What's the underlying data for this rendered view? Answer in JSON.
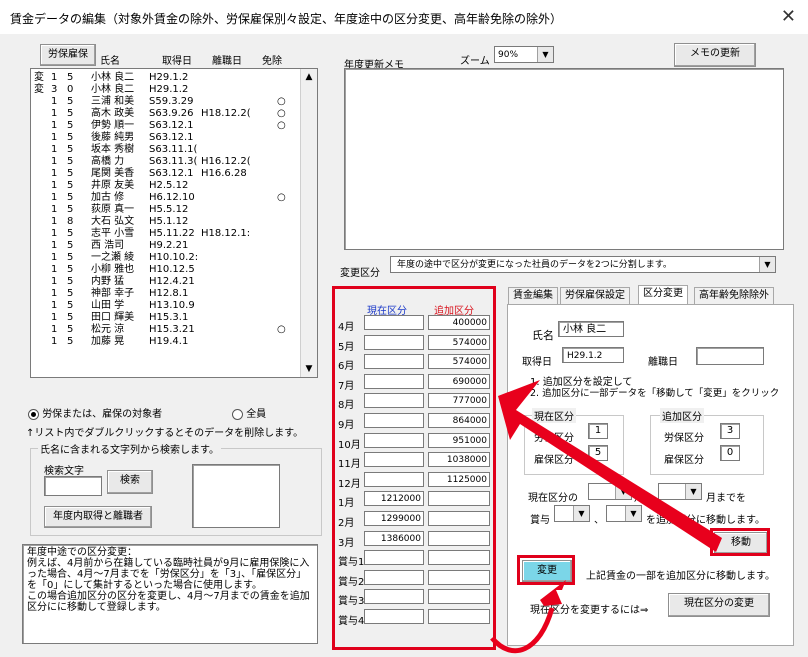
{
  "title": "賃金データの編集（対象外賃金の除外、労保雇保別々設定、年度途中の区分変更、高年齢免除の除外）",
  "close_glyph": "✕",
  "list": {
    "headers": {
      "rokoho": "労保雇保",
      "name": "氏名",
      "shutoku": "取得日",
      "rishoku": "離職日",
      "menjo": "免除"
    },
    "rows": [
      [
        "変",
        "1",
        "5",
        "小林 良二",
        "H29.1.2",
        "",
        ""
      ],
      [
        "変",
        "3",
        "0",
        "小林 良二",
        "H29.1.2",
        "",
        ""
      ],
      [
        "",
        "1",
        "5",
        "三浦 和美",
        "S59.3.29",
        "",
        "○"
      ],
      [
        "",
        "1",
        "5",
        "高木 政美",
        "S63.9.26",
        "H18.12.2(",
        "○"
      ],
      [
        "",
        "1",
        "5",
        "伊勢 順一",
        "S63.12.1",
        "",
        "○"
      ],
      [
        "",
        "1",
        "5",
        "後藤 純男",
        "S63.12.1",
        "",
        ""
      ],
      [
        "",
        "1",
        "5",
        "坂本 秀樹",
        "S63.11.1(",
        "",
        ""
      ],
      [
        "",
        "1",
        "5",
        "高橋 力",
        "S63.11.3(",
        "H16.12.2(",
        ""
      ],
      [
        "",
        "1",
        "5",
        "尾関 美香",
        "S63.12.1",
        "H16.6.28",
        ""
      ],
      [
        "",
        "1",
        "5",
        "井原 友美",
        "H2.5.12",
        "",
        ""
      ],
      [
        "",
        "1",
        "5",
        "加古 修",
        "H6.12.10",
        "",
        "○"
      ],
      [
        "",
        "1",
        "5",
        "荻原 真一",
        "H5.5.12",
        "",
        ""
      ],
      [
        "",
        "1",
        "8",
        "大石 弘文",
        "H5.1.12",
        "",
        ""
      ],
      [
        "",
        "1",
        "5",
        "志平 小雪",
        "H5.11.22",
        "H18.12.1:",
        ""
      ],
      [
        "",
        "1",
        "5",
        "西 浩司",
        "H9.2.21",
        "",
        ""
      ],
      [
        "",
        "1",
        "5",
        "一之瀬 綾",
        "H10.10.2:",
        "",
        ""
      ],
      [
        "",
        "1",
        "5",
        "小柳 雅也",
        "H10.12.5",
        "",
        ""
      ],
      [
        "",
        "1",
        "5",
        "内野 猛",
        "H12.4.21",
        "",
        ""
      ],
      [
        "",
        "1",
        "5",
        "神部 幸子",
        "H12.8.1",
        "",
        ""
      ],
      [
        "",
        "1",
        "5",
        "山田 学",
        "H13.10.9",
        "",
        ""
      ],
      [
        "",
        "1",
        "5",
        "田口 輝美",
        "H15.3.1",
        "",
        ""
      ],
      [
        "",
        "1",
        "5",
        "松元 涼",
        "H15.3.21",
        "",
        "○"
      ],
      [
        "",
        "1",
        "5",
        "加藤 晃",
        "H19.4.1",
        "",
        ""
      ]
    ]
  },
  "radio": {
    "option1": "労保または、雇保の対象者",
    "option2": "全員"
  },
  "hint_delete": "↑リスト内でダブルクリックするとそのデータを削除します。",
  "search": {
    "group_title": "氏名に含まれる文字列から検索します。",
    "label": "検索文字",
    "value": "",
    "button": "検索",
    "button2": "年度内取得と離職者"
  },
  "note": "年度中途での区分変更：\n例えば、4月前から在籍している臨時社員が9月に雇用保険に入った場合、4月～7月までを「労保区分」を「3」、「雇保区分」を「0」にして集計するといった場合に使用します。\nこの場合追加区分の区分を変更し、4月～7月までの賃金を追加区分にに移動して登録します。",
  "memo": {
    "label": "年度更新メモ",
    "zoom_label": "ズーム",
    "zoom_value": "90%",
    "update_button": "メモの更新",
    "text": ""
  },
  "henko": {
    "label": "変更区分",
    "value": "年度の途中で区分が変更になった社員のデータを2つに分割します。"
  },
  "months": {
    "header_current": "現在区分",
    "header_add": "追加区分",
    "rows": [
      {
        "m": "4月",
        "cur": "",
        "add": "400000"
      },
      {
        "m": "5月",
        "cur": "",
        "add": "574000"
      },
      {
        "m": "6月",
        "cur": "",
        "add": "574000"
      },
      {
        "m": "7月",
        "cur": "",
        "add": "690000"
      },
      {
        "m": "8月",
        "cur": "",
        "add": "777000"
      },
      {
        "m": "9月",
        "cur": "",
        "add": "864000"
      },
      {
        "m": "10月",
        "cur": "",
        "add": "951000"
      },
      {
        "m": "11月",
        "cur": "",
        "add": "1038000"
      },
      {
        "m": "12月",
        "cur": "",
        "add": "1125000"
      },
      {
        "m": "1月",
        "cur": "1212000",
        "add": ""
      },
      {
        "m": "2月",
        "cur": "1299000",
        "add": ""
      },
      {
        "m": "3月",
        "cur": "1386000",
        "add": ""
      },
      {
        "m": "賞与1",
        "cur": "",
        "add": ""
      },
      {
        "m": "賞与2",
        "cur": "",
        "add": ""
      },
      {
        "m": "賞与3",
        "cur": "",
        "add": ""
      },
      {
        "m": "賞与4",
        "cur": "",
        "add": ""
      }
    ]
  },
  "tabs": [
    "賃金編集",
    "労保雇保設定",
    "区分変更",
    "高年齢免除除外"
  ],
  "panel": {
    "name_label": "氏名",
    "name_value": "小林 良二",
    "shutoku_label": "取得日",
    "shutoku_value": "H29.1.2",
    "rishoku_label": "離職日",
    "rishoku_value": "",
    "instr1": "1. 追加区分を設定して",
    "instr2": "2. 追加区分に一部データを「移動して「変更」をクリック",
    "cur_group": "現在区分",
    "add_group": "追加区分",
    "rokoho_label": "労保区分",
    "koho_label": "雇保区分",
    "cur_rokoho": "1",
    "cur_koho": "5",
    "add_rokoho": "3",
    "add_koho": "0",
    "from_label": "現在区分の",
    "mid_label": "月",
    "until_label": "月までを",
    "bonus_label": "賞与",
    "sep": "、",
    "move_text": "を追加区分に移動します。",
    "move_button": "移動",
    "change_button": "変更",
    "change_desc": "上記賃金の一部を追加区分に移動します。",
    "change_cur_label": "現在区分を変更するには⇒",
    "change_cur_button": "現在区分の変更"
  },
  "colors": {
    "highlight": "#e0001b",
    "arrow": "#e8001c"
  }
}
